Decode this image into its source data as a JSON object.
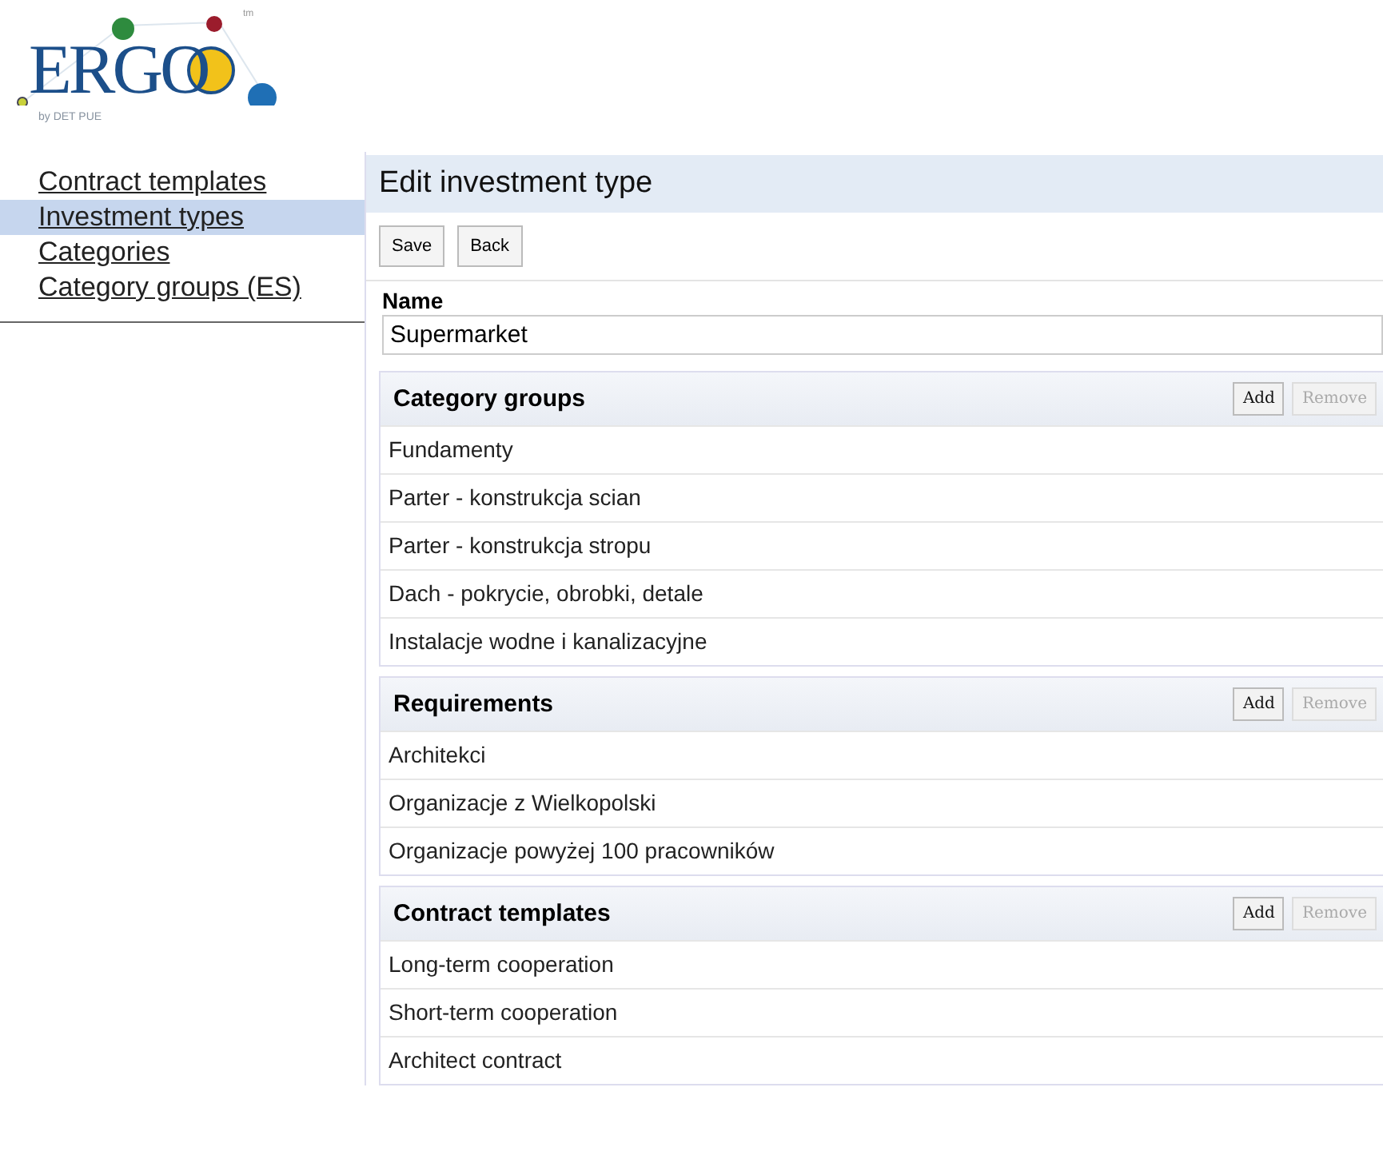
{
  "logo": {
    "wordmark": "ERGO",
    "tagline": "by DET PUE",
    "mark": "tm"
  },
  "sidebar": {
    "items": [
      {
        "label": "Contract templates",
        "selected": false
      },
      {
        "label": "Investment types",
        "selected": true
      },
      {
        "label": "Categories",
        "selected": false
      },
      {
        "label": "Category groups (ES)",
        "selected": false
      }
    ]
  },
  "page": {
    "title": "Edit investment type",
    "buttons": [
      "Save",
      "Back"
    ]
  },
  "name_field": {
    "label": "Name",
    "value": "Supermarket"
  },
  "sections": [
    {
      "title": "Category groups",
      "buttons": [
        {
          "label": "Add",
          "disabled": false
        },
        {
          "label": "Remove",
          "disabled": true
        }
      ],
      "rows": [
        "Fundamenty",
        "Parter - konstrukcja scian",
        "Parter - konstrukcja stropu",
        "Dach - pokrycie, obrobki, detale",
        "Instalacje wodne i kanalizacyjne"
      ]
    },
    {
      "title": "Requirements",
      "buttons": [
        {
          "label": "Add",
          "disabled": false
        },
        {
          "label": "Remove",
          "disabled": true
        }
      ],
      "rows": [
        "Architekci",
        "Organizacje z Wielkopolski",
        "Organizacje powyżej 100 pracowników"
      ]
    },
    {
      "title": "Contract templates",
      "buttons": [
        {
          "label": "Add",
          "disabled": false
        },
        {
          "label": "Remove",
          "disabled": true
        }
      ],
      "rows": [
        "Long-term cooperation",
        "Short-term cooperation",
        "Architect contract"
      ]
    }
  ]
}
